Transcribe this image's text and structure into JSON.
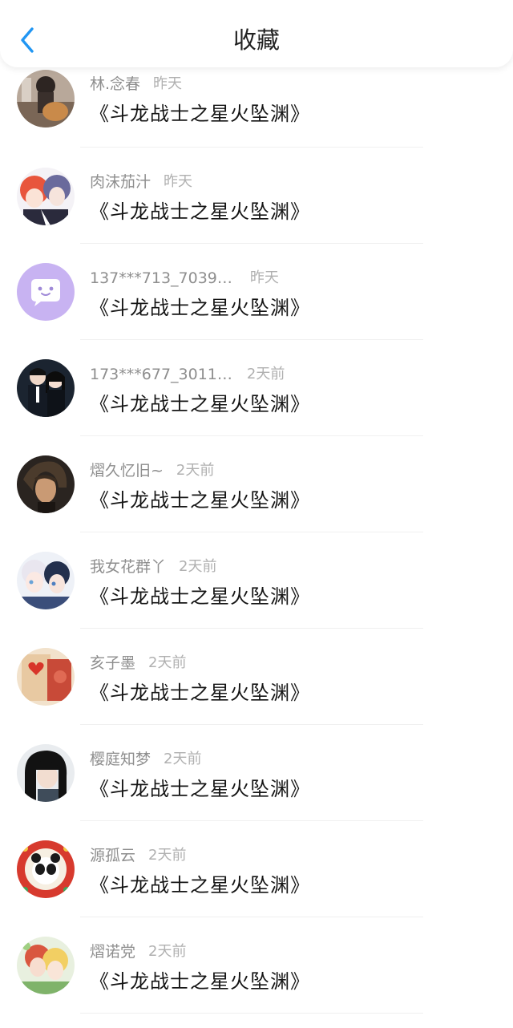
{
  "header": {
    "title": "收藏",
    "back_icon": "chevron-left-icon"
  },
  "colors": {
    "accent": "#2196F3",
    "title_text": "#222222",
    "username_text": "#8e8e8e",
    "time_text": "#b0b0b0",
    "book_text": "#151515"
  },
  "favorites": [
    {
      "user": "林.念春",
      "time": "昨天",
      "book": "《斗龙战士之星火坠渊》"
    },
    {
      "user": "肉沫茄汁",
      "time": "昨天",
      "book": "《斗龙战士之星火坠渊》"
    },
    {
      "user": "137***713_7039…",
      "time": "昨天",
      "book": "《斗龙战士之星火坠渊》"
    },
    {
      "user": "173***677_3011…",
      "time": "2天前",
      "book": "《斗龙战士之星火坠渊》"
    },
    {
      "user": "熠久忆旧~",
      "time": "2天前",
      "book": "《斗龙战士之星火坠渊》"
    },
    {
      "user": "我女花群丫",
      "time": "2天前",
      "book": "《斗龙战士之星火坠渊》"
    },
    {
      "user": "亥子墨",
      "time": "2天前",
      "book": "《斗龙战士之星火坠渊》"
    },
    {
      "user": "樱庭知梦",
      "time": "2天前",
      "book": "《斗龙战士之星火坠渊》"
    },
    {
      "user": "源孤云",
      "time": "2天前",
      "book": "《斗龙战士之星火坠渊》"
    },
    {
      "user": "熠诺党",
      "time": "2天前",
      "book": "《斗龙战士之星火坠渊》"
    }
  ]
}
